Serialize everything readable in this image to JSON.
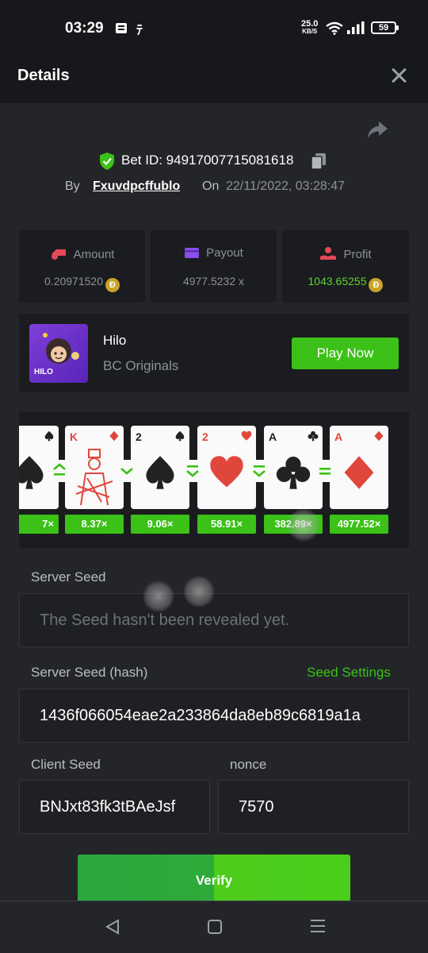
{
  "status_bar": {
    "time": "03:29",
    "net_speed": "25.0",
    "net_speed_unit": "KB/S",
    "battery": "59"
  },
  "header": {
    "title": "Details"
  },
  "bet": {
    "id_label": "Bet ID: 94917007715081618",
    "by_label": "By",
    "user": "Fxuvdpcffublo",
    "on_label": "On",
    "datetime": "22/11/2022, 03:28:47"
  },
  "stats": {
    "amount_label": "Amount",
    "amount_value": "0.20971520",
    "payout_label": "Payout",
    "payout_value": "4977.5232 x",
    "profit_label": "Profit",
    "profit_value": "1043.65255",
    "coin_symbol": "Ð"
  },
  "game": {
    "name": "Hilo",
    "provider": "BC Originals",
    "thumb_label": "HILO",
    "play_label": "Play Now"
  },
  "cards": [
    {
      "rank": "",
      "suit": "spade",
      "color": "#222222"
    },
    {
      "rank": "K",
      "suit": "diamond",
      "color": "#e0473c"
    },
    {
      "rank": "2",
      "suit": "spade",
      "color": "#222222"
    },
    {
      "rank": "2",
      "suit": "heart",
      "color": "#e0473c"
    },
    {
      "rank": "A",
      "suit": "club",
      "color": "#222222"
    },
    {
      "rank": "A",
      "suit": "diamond",
      "color": "#e0473c"
    }
  ],
  "multipliers": [
    "7×",
    "8.37×",
    "9.06×",
    "58.91×",
    "382.89×",
    "4977.52×"
  ],
  "seeds": {
    "server_seed_label": "Server Seed",
    "server_seed_value": "The Seed hasn't been revealed yet.",
    "server_hash_label": "Server Seed (hash)",
    "seed_settings_label": "Seed Settings",
    "server_hash_value": "1436f066054eae2a233864da8eb89c6819a1a",
    "client_seed_label": "Client Seed",
    "client_seed_value": "BNJxt83fk3tBAeJsf",
    "nonce_label": "nonce",
    "nonce_value": "7570"
  },
  "verify_label": "Verify",
  "colors": {
    "accent_green": "#3bc117",
    "background": "#232529",
    "panel": "#1a1c1f"
  }
}
